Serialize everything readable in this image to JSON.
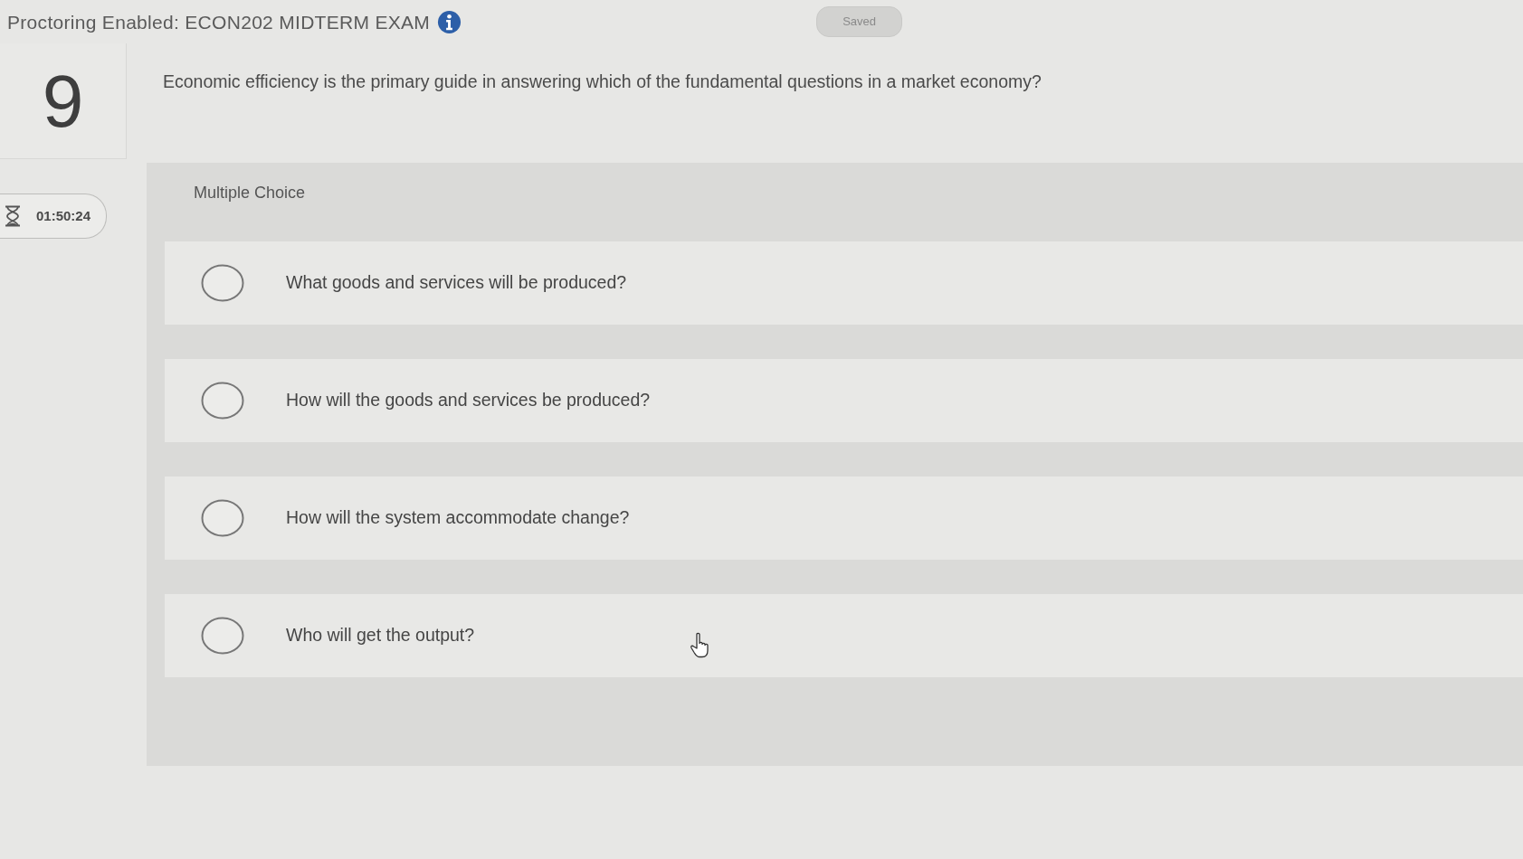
{
  "header": {
    "title": "Proctoring Enabled: ECON202 MIDTERM EXAM",
    "save_status": "Saved"
  },
  "question": {
    "number": "9",
    "timer": "01:50:24",
    "text": "Economic efficiency is the primary guide in answering which of the fundamental questions in a market economy?",
    "type_label": "Multiple Choice",
    "options": [
      {
        "label": "What goods and services will be produced?",
        "selected": false
      },
      {
        "label": "How will the goods and services be produced?",
        "selected": false
      },
      {
        "label": "How will the system accommodate change?",
        "selected": false
      },
      {
        "label": "Who will get the output?",
        "selected": false
      }
    ]
  }
}
